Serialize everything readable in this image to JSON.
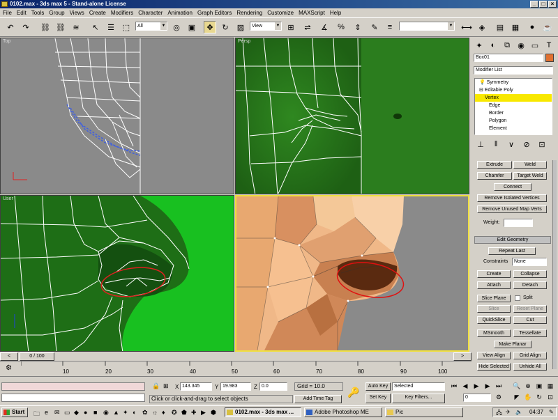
{
  "window": {
    "title": "0102.max - 3ds max 5 - Stand-alone License",
    "minimize": "_",
    "maximize": "□",
    "close": "×"
  },
  "menu": [
    "File",
    "Edit",
    "Tools",
    "Group",
    "Views",
    "Create",
    "Modifiers",
    "Character",
    "Animation",
    "Graph Editors",
    "Rendering",
    "Customize",
    "MAXScript",
    "Help"
  ],
  "toolbar": {
    "selection_filter": "All",
    "reference_coord": "View",
    "named_selection": ""
  },
  "viewports": {
    "top_label": "Top",
    "persp_label": "Persp",
    "user_label": "User",
    "camera_label": ""
  },
  "command_panel": {
    "object_name": "Box01",
    "object_color": "#e07030",
    "modifier_list": "Modifier List",
    "stack": [
      {
        "label": "Symmetry",
        "level": 0
      },
      {
        "label": "Editable Poly",
        "level": 0
      },
      {
        "label": "Vertex",
        "level": 1,
        "selected": true
      },
      {
        "label": "Edge",
        "level": 1
      },
      {
        "label": "Border",
        "level": 1
      },
      {
        "label": "Polygon",
        "level": 1
      },
      {
        "label": "Element",
        "level": 1
      }
    ],
    "buttons": {
      "extrude": "Extrude",
      "weld": "Weld",
      "chamfer": "Chamfer",
      "target_weld": "Target Weld",
      "connect": "Connect",
      "remove_isolated": "Remove Isolated Vertices",
      "remove_unused": "Remove Unused Map Verts",
      "weight_label": "Weight:",
      "weight_value": "",
      "edit_geometry": "Edit Geometry",
      "repeat_last": "Repeat Last",
      "constraints_label": "Constraints",
      "constraints_value": "None",
      "create": "Create",
      "collapse": "Collapse",
      "attach": "Attach",
      "detach": "Detach",
      "slice_plane": "Slice Plane",
      "split": "Split",
      "slice": "Slice",
      "reset_plane": "Reset Plane",
      "quickslice": "QuickSlice",
      "cut": "Cut",
      "msmooth": "MSmooth",
      "tessellate": "Tessellate",
      "make_planar": "Make Planar",
      "view_align": "View Align",
      "grid_align": "Grid Align",
      "hide_selected": "Hide Selected",
      "unhide_all": "Unhide All"
    }
  },
  "timeline": {
    "frame_display": "0 / 100",
    "ticks": [
      "10",
      "20",
      "30",
      "40",
      "50",
      "60",
      "70",
      "80",
      "90",
      "100"
    ]
  },
  "status": {
    "x_label": "X",
    "x_value": "143.345",
    "y_label": "Y",
    "y_value": "19.983",
    "z_label": "Z",
    "z_value": "0.0",
    "grid": "Grid = 10.0",
    "prompt": "Click or click-and-drag to select objects",
    "add_time_tag": "Add Time Tag",
    "auto_key": "Auto Key",
    "set_key": "Set Key",
    "key_mode": "Selected",
    "key_filters": "Key Filters...",
    "current_frame": "0"
  },
  "taskbar": {
    "start": "Start",
    "items": [
      {
        "label": "0102.max - 3ds max ...",
        "active": true
      },
      {
        "label": "Adobe Photoshop ME",
        "active": false
      },
      {
        "label": "Pic",
        "active": false
      }
    ],
    "clock": "04:37"
  }
}
